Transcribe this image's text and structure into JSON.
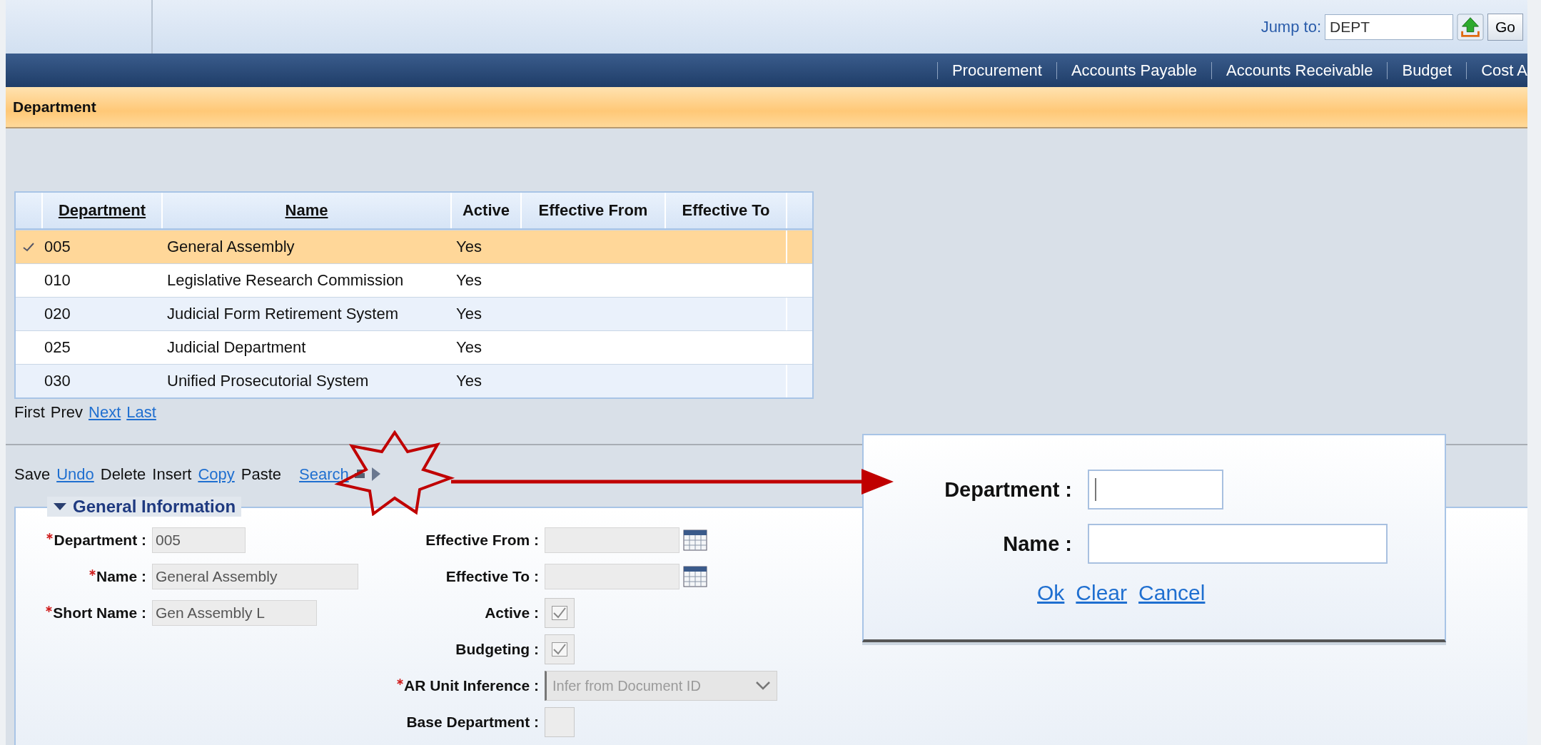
{
  "header": {
    "jump_label": "Jump to:",
    "jump_value": "DEPT",
    "go_button": "Go"
  },
  "nav": [
    {
      "label": "Procurement"
    },
    {
      "label": "Accounts Payable"
    },
    {
      "label": "Accounts Receivable"
    },
    {
      "label": "Budget"
    },
    {
      "label": "Cost A"
    }
  ],
  "page_title": "Department",
  "table": {
    "columns": [
      {
        "label": "Department",
        "sortable": true
      },
      {
        "label": "Name",
        "sortable": true
      },
      {
        "label": "Active",
        "sortable": false
      },
      {
        "label": "Effective From",
        "sortable": false
      },
      {
        "label": "Effective To",
        "sortable": false
      }
    ],
    "rows": [
      {
        "selected": true,
        "cells": [
          "005",
          "General Assembly",
          "Yes"
        ]
      },
      {
        "selected": false,
        "cells": [
          "010",
          "Legislative Research Commission",
          "Yes"
        ]
      },
      {
        "selected": false,
        "cells": [
          "020",
          "Judicial Form Retirement System",
          "Yes"
        ]
      },
      {
        "selected": false,
        "cells": [
          "025",
          "Judicial Department",
          "Yes"
        ]
      },
      {
        "selected": false,
        "cells": [
          "030",
          "Unified Prosecutorial System",
          "Yes"
        ]
      }
    ]
  },
  "pager": [
    {
      "label": "First",
      "enabled": false
    },
    {
      "label": "Prev",
      "enabled": false
    },
    {
      "label": "Next",
      "enabled": true
    },
    {
      "label": "Last",
      "enabled": true
    }
  ],
  "toolbar": [
    {
      "label": "Save",
      "enabled": false
    },
    {
      "label": "Undo",
      "enabled": true
    },
    {
      "label": "Delete",
      "enabled": false
    },
    {
      "label": "Insert",
      "enabled": false
    },
    {
      "label": "Copy",
      "enabled": true
    },
    {
      "label": "Paste",
      "enabled": false
    },
    {
      "label": "Search",
      "enabled": true
    }
  ],
  "section": {
    "title": "General Information",
    "expanded": true,
    "left_fields": [
      {
        "label": "Department :",
        "required": true,
        "value": "005"
      },
      {
        "label": "Name :",
        "required": true,
        "value": "General Assembly"
      },
      {
        "label": "Short Name :",
        "required": true,
        "value": "Gen Assembly L"
      }
    ],
    "right_fields": [
      {
        "label": "Effective From :",
        "required": false,
        "kind": "date"
      },
      {
        "label": "Effective To :",
        "required": false,
        "kind": "date"
      },
      {
        "label": "Active :",
        "required": false,
        "kind": "checkbox",
        "checked": true
      },
      {
        "label": "Budgeting :",
        "required": false,
        "kind": "checkbox",
        "checked": true
      },
      {
        "label": "AR Unit Inference :",
        "required": true,
        "kind": "select",
        "value": "Infer from Document ID"
      },
      {
        "label": "Base Department :",
        "required": false,
        "kind": "checkbox",
        "checked": false
      }
    ]
  },
  "search_popup": {
    "fields": [
      {
        "label": "Department :",
        "focused": true
      },
      {
        "label": "Name :",
        "focused": false
      }
    ],
    "links": [
      "Ok",
      "Clear",
      "Cancel"
    ]
  }
}
